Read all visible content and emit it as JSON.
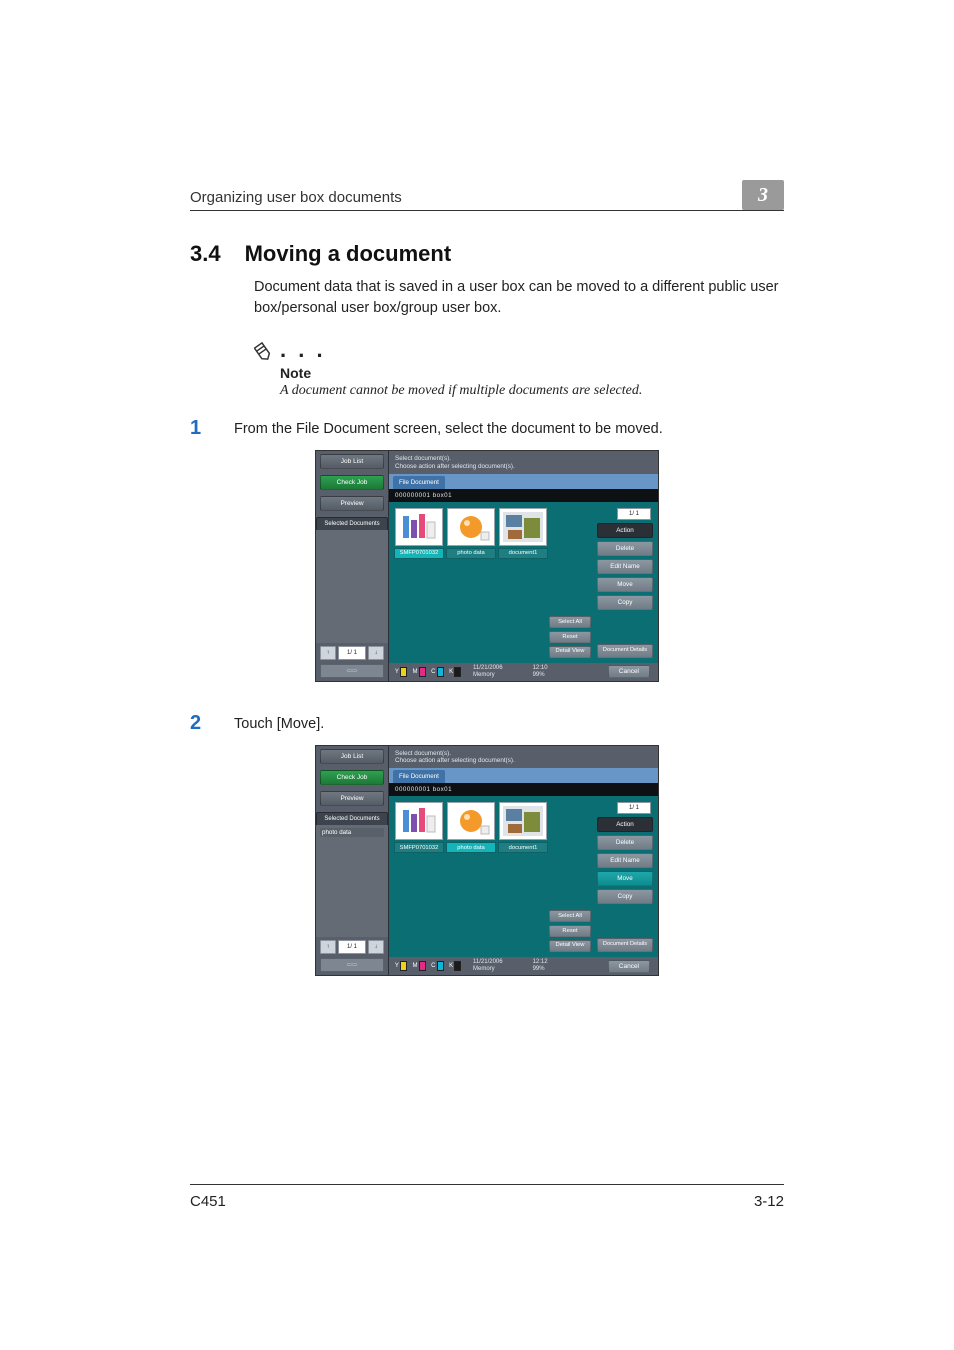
{
  "header": {
    "left": "Organizing user box documents",
    "chapter": "3"
  },
  "section": {
    "number": "3.4",
    "title": "Moving a document"
  },
  "body_p1": "Document data that is saved in a user box can be moved to a different public user box/personal user box/group user box.",
  "note": {
    "label": "Note",
    "text": "A document cannot be moved if multiple documents are selected."
  },
  "steps": [
    {
      "num": "1",
      "text": "From the File Document screen, select the document to be moved."
    },
    {
      "num": "2",
      "text": "Touch [Move]."
    }
  ],
  "footer": {
    "left": "C451",
    "right": "3-12"
  },
  "screens": [
    {
      "left": {
        "job_list": "Job List",
        "check_job": "Check Job",
        "preview": "Preview",
        "sel_docs": "Selected Documents",
        "sel_items": [],
        "pager": {
          "up": "↑",
          "mid": "1/  1",
          "down": "↓"
        },
        "tray": ""
      },
      "top": {
        "l1": "Select document(s).",
        "l2": "Choose action after selecting document(s)."
      },
      "tab": "File Document",
      "infobar": "000000001   box01",
      "thumbs": [
        {
          "label": "SMFP0701032",
          "sel": true,
          "kind": "bars"
        },
        {
          "label": "photo data",
          "sel": false,
          "kind": "orange"
        },
        {
          "label": "document1",
          "sel": false,
          "kind": "busy"
        }
      ],
      "pageind": "1/  1",
      "side": {
        "action": "Action",
        "delete": "Delete",
        "edit": "Edit Name",
        "move": "Move",
        "copy": "Copy",
        "docdet": "Document\nDetails"
      },
      "ctr": {
        "selall": "Select\nAll",
        "reset": "Reset",
        "detail": "Detail\nView"
      },
      "foot": {
        "date": "11/21/2006",
        "time": "12:10",
        "mem": "Memory",
        "mempct": "99%",
        "cancel": "Cancel"
      },
      "toner": [
        "Y",
        "M",
        "C",
        "K"
      ]
    },
    {
      "left": {
        "job_list": "Job List",
        "check_job": "Check Job",
        "preview": "Preview",
        "sel_docs": "Selected Documents",
        "sel_items": [
          "photo data"
        ],
        "pager": {
          "up": "↑",
          "mid": "1/  1",
          "down": "↓"
        },
        "tray": ""
      },
      "top": {
        "l1": "Select document(s).",
        "l2": "Choose action after selecting document(s)."
      },
      "tab": "File Document",
      "infobar": "000000001   box01",
      "thumbs": [
        {
          "label": "SMFP0701032",
          "sel": false,
          "kind": "bars"
        },
        {
          "label": "photo data",
          "sel": true,
          "kind": "orange"
        },
        {
          "label": "document1",
          "sel": false,
          "kind": "busy"
        }
      ],
      "pageind": "1/  1",
      "side": {
        "action": "Action",
        "delete": "Delete",
        "edit": "Edit Name",
        "move": "Move",
        "copy": "Copy",
        "docdet": "Document\nDetails"
      },
      "side_highlight": "move",
      "ctr": {
        "selall": "Select\nAll",
        "reset": "Reset",
        "detail": "Detail\nView"
      },
      "foot": {
        "date": "11/21/2006",
        "time": "12:12",
        "mem": "Memory",
        "mempct": "99%",
        "cancel": "Cancel"
      },
      "toner": [
        "Y",
        "M",
        "C",
        "K"
      ]
    }
  ]
}
